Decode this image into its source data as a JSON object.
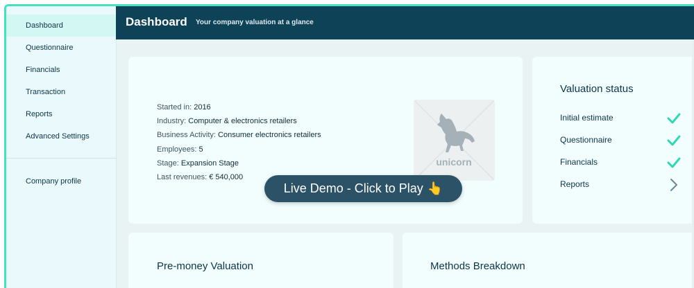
{
  "sidebar": {
    "items": [
      {
        "label": "Dashboard",
        "active": true
      },
      {
        "label": "Questionnaire"
      },
      {
        "label": "Financials"
      },
      {
        "label": "Transaction"
      },
      {
        "label": "Reports"
      },
      {
        "label": "Advanced Settings"
      }
    ],
    "profile": {
      "label": "Company profile"
    }
  },
  "header": {
    "title": "Dashboard",
    "subtitle": "Your company valuation at a glance"
  },
  "company": {
    "fields": [
      {
        "label": "Started in: ",
        "value": "2016"
      },
      {
        "label": "Industry: ",
        "value": "Computer & electronics retailers"
      },
      {
        "label": "Business Activity: ",
        "value": "Consumer electronics retailers"
      },
      {
        "label": "Employees: ",
        "value": "5"
      },
      {
        "label": "Stage: ",
        "value": "Expansion Stage"
      },
      {
        "label": "Last revenues: ",
        "value": "€ 540,000"
      }
    ],
    "logo_text": "unicorn"
  },
  "status": {
    "title": "Valuation status",
    "rows": [
      {
        "label": "Initial estimate",
        "icon": "check-icon"
      },
      {
        "label": "Questionnaire",
        "icon": "check-icon"
      },
      {
        "label": "Financials",
        "icon": "check-icon"
      },
      {
        "label": "Reports",
        "icon": "chevron-right-icon"
      }
    ]
  },
  "cards": {
    "premoney_title": "Pre-money Valuation",
    "methods_title": "Methods Breakdown"
  },
  "demo": {
    "label": "Live Demo - Click to Play"
  },
  "colors": {
    "accent": "#43e3c0",
    "header_bg": "#0e4357",
    "sidebar_bg": "#eaf9fb",
    "check": "#2dd9b5"
  }
}
